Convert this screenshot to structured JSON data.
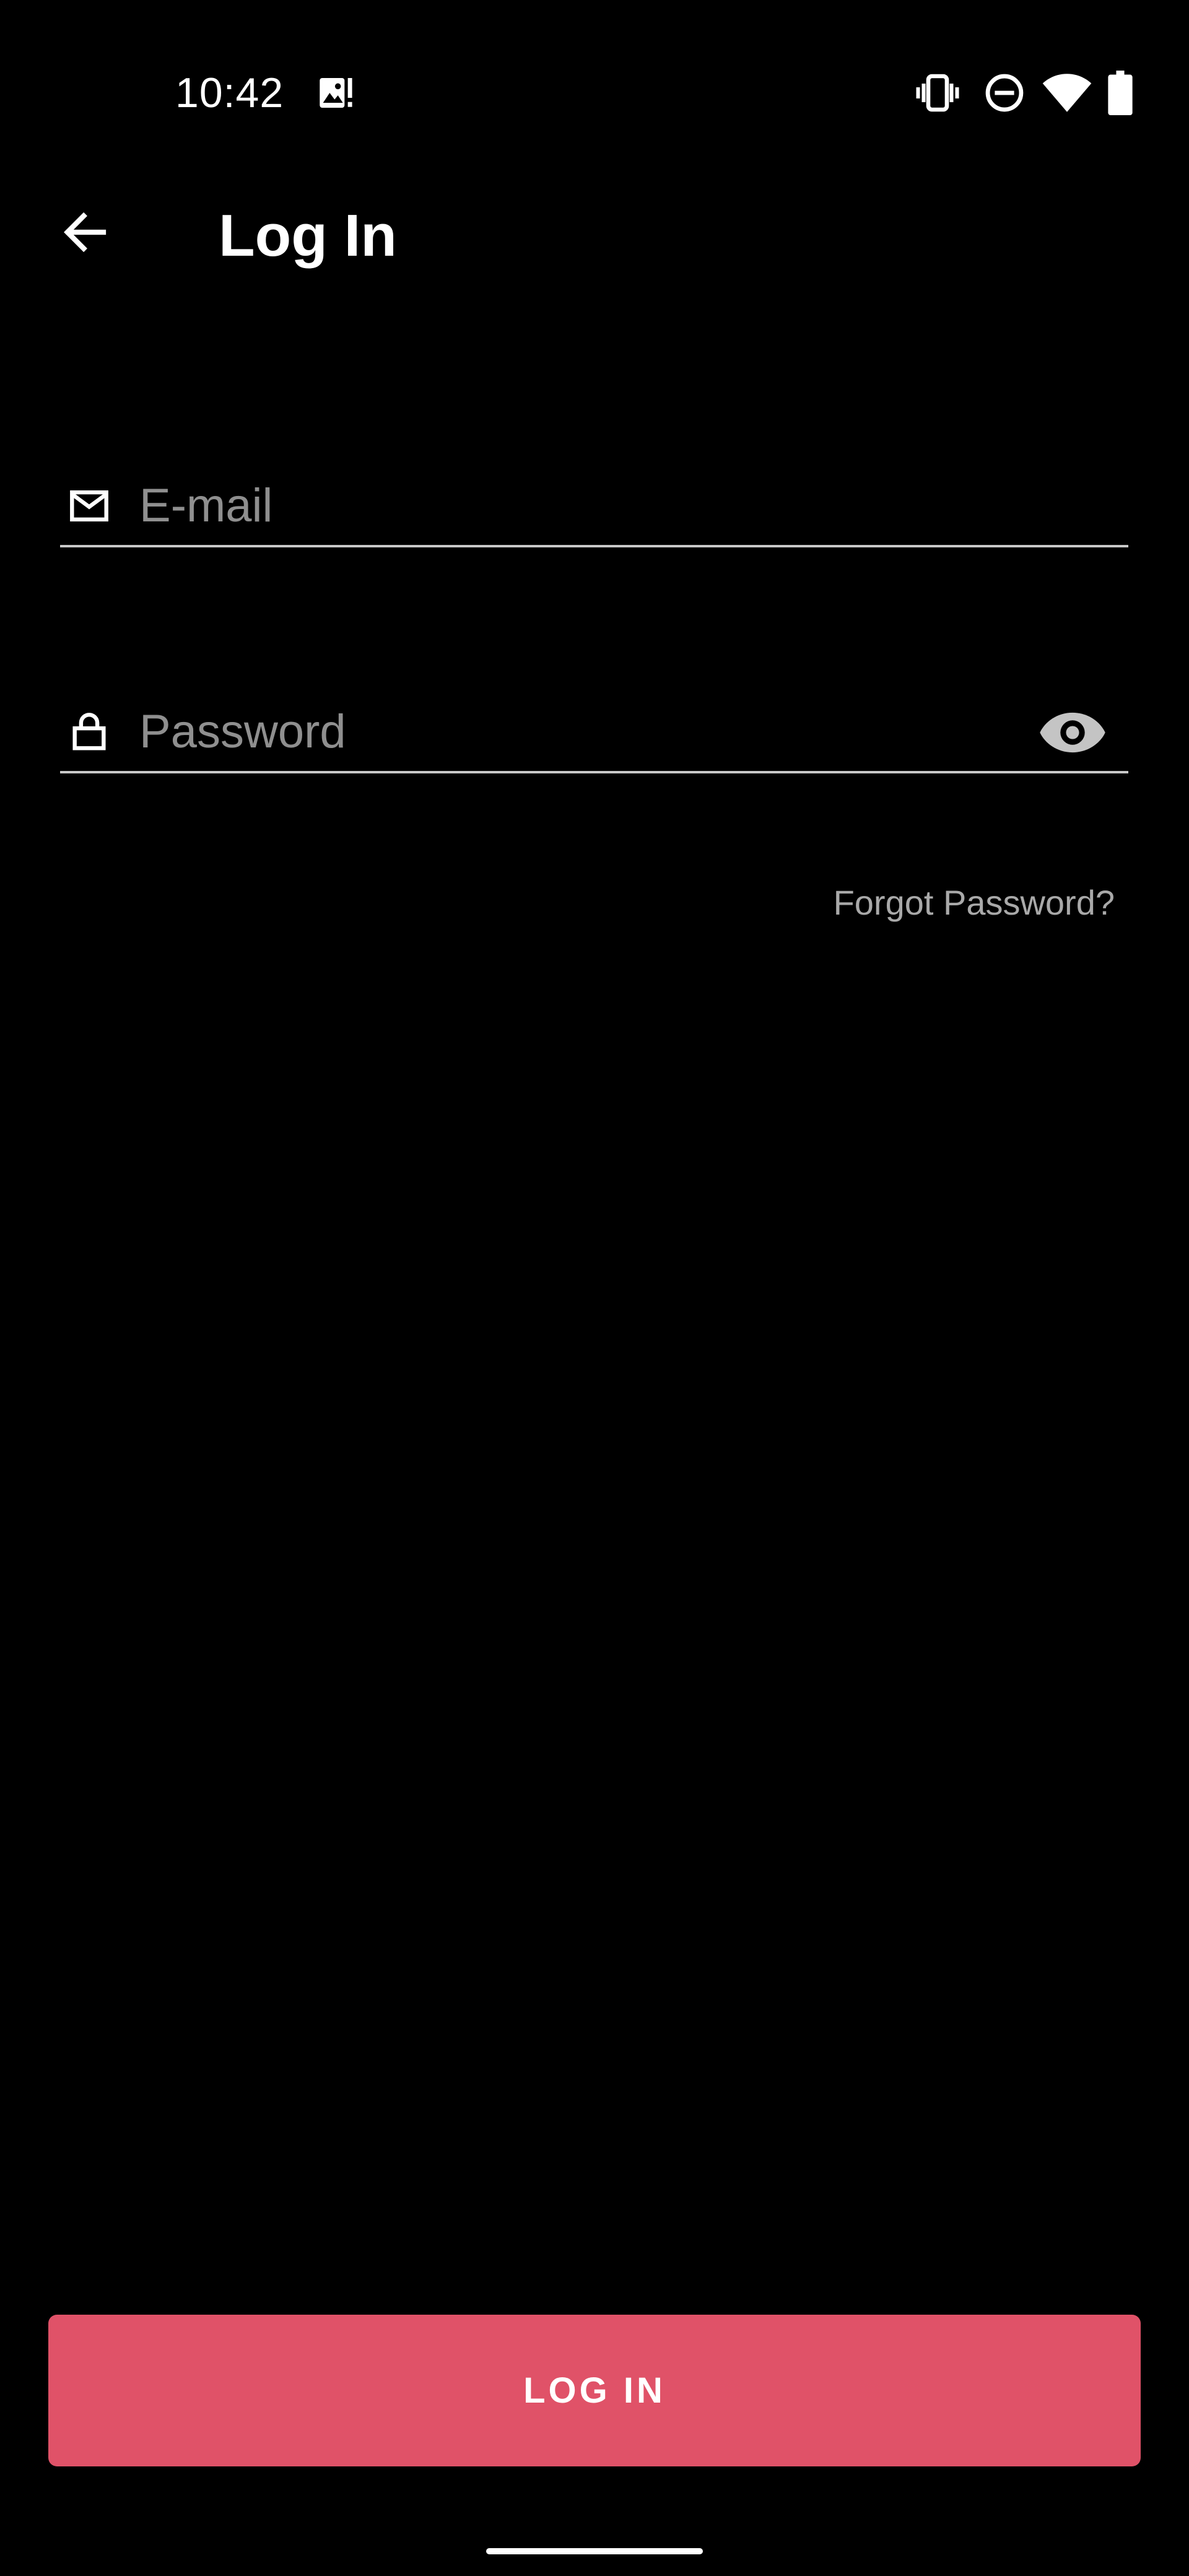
{
  "status_bar": {
    "time": "10:42",
    "icons": [
      "image-alert-icon",
      "vibrate-icon",
      "do-not-disturb-icon",
      "wifi-icon",
      "battery-icon"
    ]
  },
  "app_bar": {
    "back_icon": "arrow-back-icon",
    "title": "Log In"
  },
  "form": {
    "email": {
      "icon": "mail-icon",
      "value": "",
      "placeholder": "E-mail"
    },
    "password": {
      "icon": "lock-icon",
      "value": "",
      "placeholder": "Password",
      "toggle_icon": "eye-icon"
    },
    "forgot_label": "Forgot Password?",
    "submit_label": "LOG IN"
  },
  "colors": {
    "background": "#000000",
    "accent": "#e05268",
    "placeholder": "#8f8f8f",
    "link": "#a9a9a9"
  }
}
